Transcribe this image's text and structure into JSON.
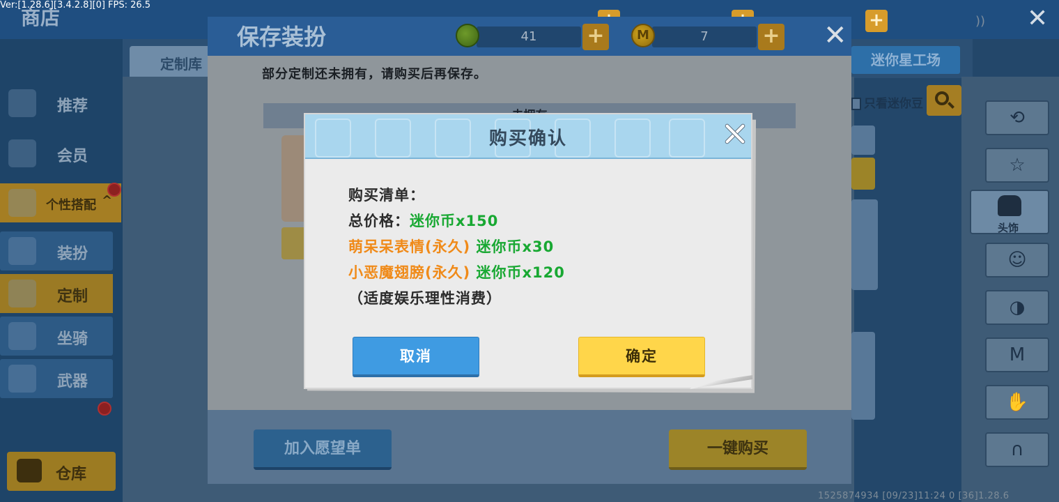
{
  "debug": {
    "version_text": "Ver:[1.28.6][3.4.2.8][0] FPS: 26.5"
  },
  "shop": {
    "title": "商店",
    "sidebar": [
      {
        "label": "推荐",
        "icon": "thumbs-up-icon"
      },
      {
        "label": "会员",
        "icon": "member-card-icon"
      },
      {
        "label": "个性搭配",
        "icon": "outfit-icon",
        "suffix": "^"
      },
      {
        "label": "装扮",
        "icon": "outfit-icon"
      },
      {
        "label": "定制",
        "icon": "pencil-icon"
      },
      {
        "label": "坐骑",
        "icon": "mount-icon"
      },
      {
        "label": "武器",
        "icon": "gun-icon"
      }
    ],
    "storage_label": "仓库",
    "tab_left": "定制库",
    "tab_right": "迷你星工场",
    "only_mini_beans": "只看迷你豆",
    "right_panel": {
      "selected_label": "头饰",
      "icons": [
        "history-icon",
        "shirt-star-icon",
        "head-accessory-icon",
        "face-icon",
        "mask-icon",
        "shirt-m-icon",
        "glove-icon",
        "pants-icon"
      ]
    },
    "footer_id": "1525874934  [09/23]11:24 0   [36]1.28.6",
    "accent_yellow": "#d7a531",
    "accent_blue": "#2d6fa8"
  },
  "save_dialog": {
    "title": "保存装扮",
    "currency_green": {
      "amount": "41",
      "icon": "mini-bean-icon"
    },
    "currency_gold": {
      "amount": "7",
      "icon": "mini-coin-icon"
    },
    "message": "部分定制还未拥有，请购买后再保存。",
    "unowned_label": "未拥有",
    "wishlist_label": "加入愿望单",
    "buy_all_label": "一键购买"
  },
  "confirm_dialog": {
    "title": "购买确认",
    "list_label": "购买清单：",
    "total_label": "总价格：",
    "total_value": "迷你币x150",
    "items": [
      {
        "name": "萌呆呆表情(永久)",
        "price": "迷你币x30"
      },
      {
        "name": "小恶魔翅膀(永久)",
        "price": "迷你币x120"
      }
    ],
    "note": "（适度娱乐理性消费）",
    "cancel_label": "取消",
    "ok_label": "确定",
    "colors": {
      "price_green": "#18a832",
      "item_orange": "#f08a18",
      "cancel_blue": "#3f9be2",
      "ok_yellow": "#ffd64a"
    }
  }
}
